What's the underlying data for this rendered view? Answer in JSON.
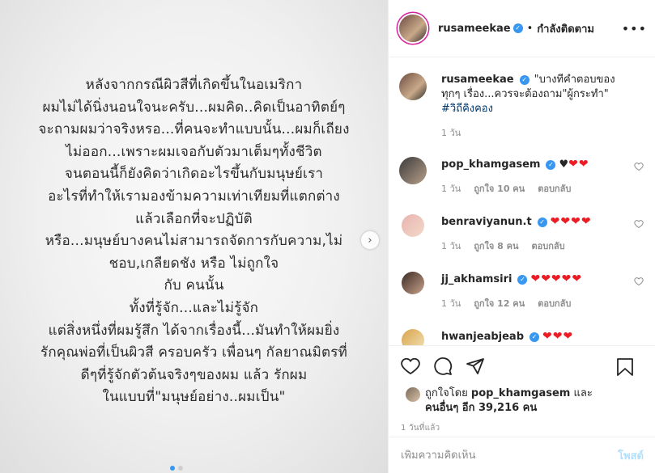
{
  "post_image": {
    "lines": [
      "หลังจากกรณีผิวสีที่เกิดขึ้นในอเมริกา",
      "ผมไม่ได้นิ่งนอนใจนะครับ...ผมคิด..คิดเป็นอาทิตย์ๆ",
      "จะถามผมว่าจริงหรอ...ที่คนจะทำแบบนั้น...ผมก็เถียง",
      "ไม่ออก...เพราะผมเจอกับตัวมาเต็มๆทั้งชีวิต",
      "จนตอนนี้ก็ยังคิดว่าเกิดอะไรขึ้นกับมนุษย์เรา",
      "อะไรที่ทำให้เรามองข้ามความเท่าเทียมที่แตกต่าง",
      "แล้วเลือกที่จะปฏิบัติ",
      "หรือ...มนุษย์บางคนไม่สามารถจัดการกับความ,ไม่",
      "ชอบ,เกลียดชัง หรือ ไม่ถูกใจ",
      "กับ คนนั้น",
      "ทั้งที่รู้จัก...และไม่รู้จัก",
      "แต่สิ่งหนึ่งที่ผมรู้สึก ได้จากเรื่องนี้...มันทำให้ผมยิ่ง",
      "รักคุณพ่อที่เป็นผิวสี ครอบครัว เพื่อนๆ กัลยาณมิตรที่",
      "ดีๆที่รู้จักตัวต้นจริงๆของผม แล้ว รักผม",
      "ในแบบที่\"มนุษย์อย่าง..ผมเป็น\""
    ],
    "next_icon": "chevron-right-icon"
  },
  "header": {
    "username": "rusameekae",
    "separator": "•",
    "follow_status": "กำลังติดตาม",
    "more_icon": "•••"
  },
  "caption": {
    "username": "rusameekae",
    "text": "\"บางทีคำตอบของทุกๆ เรื่อง...ควรจะต้องถาม\"ผู้กระทำ\"",
    "hashtag": "#วิถีคิงคอง",
    "time": "1 วัน"
  },
  "comments": [
    {
      "username": "pop_khamgasem",
      "text": "♥",
      "hearts": "❤❤",
      "time": "1 วัน",
      "likes": "ถูกใจ 10 คน",
      "reply": "ตอบกลับ"
    },
    {
      "username": "benraviyanun.t",
      "text": "",
      "hearts": "❤❤❤❤",
      "time": "1 วัน",
      "likes": "ถูกใจ 8 คน",
      "reply": "ตอบกลับ"
    },
    {
      "username": "jj_akhamsiri",
      "text": "",
      "hearts": "❤❤❤❤❤",
      "time": "1 วัน",
      "likes": "ถูกใจ 12 คน",
      "reply": "ตอบกลับ"
    },
    {
      "username": "hwanjeabjeab",
      "text": "",
      "hearts": "❤❤❤",
      "time": "",
      "likes": "",
      "reply": ""
    }
  ],
  "likes": {
    "prefix": "ถูกใจโดย",
    "user": "pop_khamgasem",
    "conj": "และ",
    "others": "คนอื่นๆ อีก 39,216 คน"
  },
  "posted_ago": "1 วันที่แล้ว",
  "add_comment": {
    "placeholder": "เพิ่มความคิดเห็น",
    "post_label": "โพสต์"
  },
  "colors": {
    "accent": "#3897f0",
    "heart": "#ed1c24",
    "muted": "#8e8e8e"
  }
}
